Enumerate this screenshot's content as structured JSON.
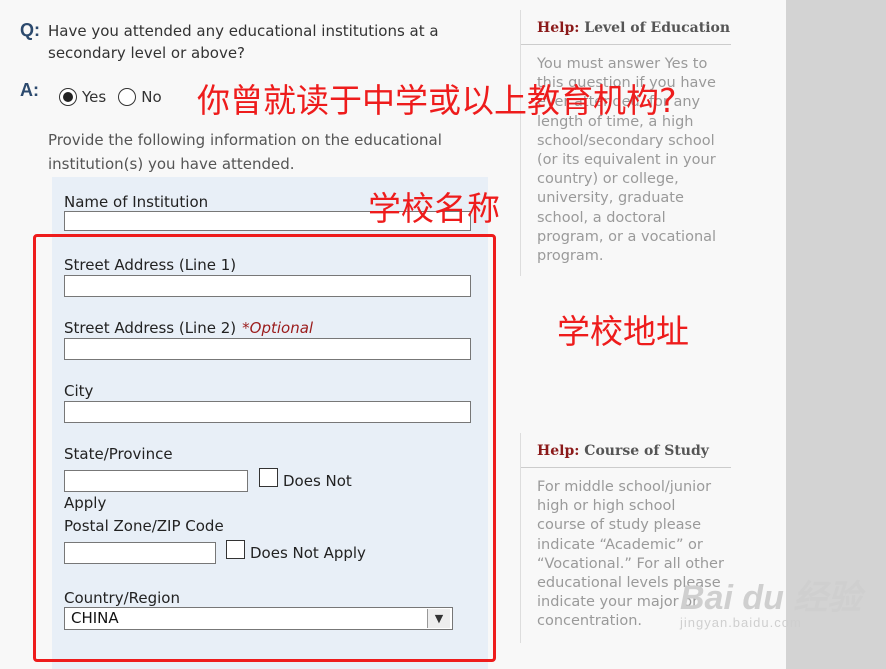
{
  "question": {
    "q_marker": "Q:",
    "text": "Have you attended any educational institutions at a secondary level or above?"
  },
  "answer": {
    "a_marker": "A:",
    "options": [
      {
        "label": "Yes",
        "selected": true
      },
      {
        "label": "No",
        "selected": false
      }
    ],
    "instructions": "Provide the following information on the educational institution(s) you have attended."
  },
  "form": {
    "name_label": "Name of Institution",
    "street1_label": "Street Address (Line 1)",
    "street2_label": "Street Address (Line 2)",
    "optional_note": "*Optional",
    "city_label": "City",
    "state_label": "State/Province",
    "state_does_not_apply": "Does Not",
    "state_does_not_apply_cont": "Apply",
    "postal_label": "Postal Zone/ZIP Code",
    "postal_does_not_apply": "Does Not Apply",
    "country_label": "Country/Region",
    "country_value": "CHINA"
  },
  "help": [
    {
      "lead": "Help:",
      "title": "Level of Education",
      "body": "You must answer Yes to this question if you have ever attended, for any length of time, a high school/secondary school (or its equivalent in your country) or college, university, graduate school, a doctoral program, or a vocational program."
    },
    {
      "lead": "Help:",
      "title": "Course of Study",
      "body": "For middle school/junior high or high school course of study please indicate “Academic” or “Vocational.” For all other educational levels please indicate your major or concentration."
    }
  ],
  "annotations": {
    "question_cn": "你曾就读于中学或以上教育机构?",
    "name_cn": "学校名称",
    "address_cn": "学校地址"
  },
  "watermark": {
    "logo": "Bai du 经验",
    "sub": "jingyan.baidu.com"
  },
  "colors": {
    "annotation_red": "#ee1c1c",
    "form_panel_bg": "#e8eff7",
    "help_lead": "#8b1a1a",
    "marker_blue": "#2c4a6e"
  }
}
